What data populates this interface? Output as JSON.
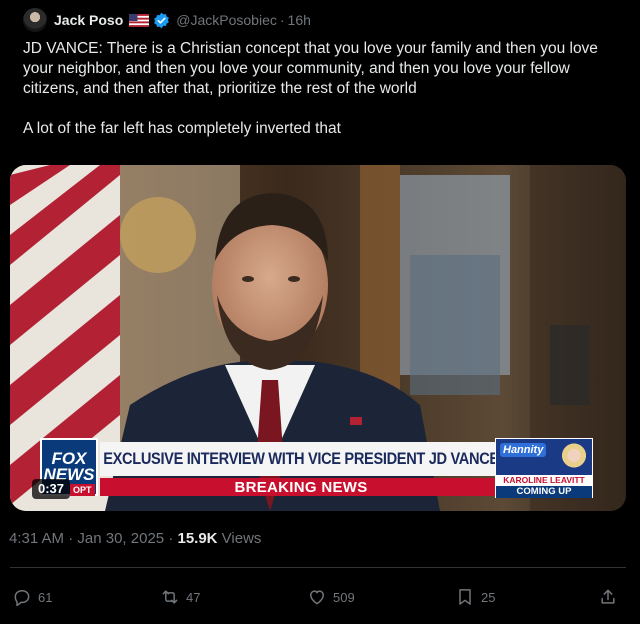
{
  "tweet": {
    "author": {
      "display_name": "Jack Poso",
      "handle": "@JackPosobiec",
      "flag_icon": "us-flag-icon",
      "verified_icon": "verified-badge-icon",
      "verified_color": "#1d9bf0"
    },
    "separator": "·",
    "time_ago": "16h",
    "paragraphs": [
      "JD VANCE: There is a Christian concept that you love your family and then you love your neighbor, and then you love your community, and then you love your fellow citizens, and then after that, prioritize the rest of the world",
      "A lot of the far left has completely inverted that"
    ],
    "video": {
      "duration": "0:37",
      "chyron_logo_top": "FOX",
      "chyron_logo_bottom": "NEWS",
      "chyron_logo_tag": "OPT",
      "headline": "EXCLUSIVE INTERVIEW WITH VICE PRESIDENT JD VANCE",
      "breaking": "BREAKING NEWS",
      "promo_show": "Hannity",
      "promo_name": "KAROLINE LEAVITT",
      "promo_coming": "COMING UP",
      "brand_red": "#c8102e",
      "brand_blue": "#0b3a7a"
    },
    "meta": {
      "time": "4:31 AM",
      "separator": "·",
      "date": "Jan 30, 2025",
      "separator2": "·",
      "views_count": "15.9K",
      "views_label": " Views"
    },
    "actions": {
      "replies": "61",
      "reposts": "47",
      "likes": "509",
      "bookmarks": "25",
      "icons": [
        "reply-icon",
        "repost-icon",
        "like-icon",
        "bookmark-icon",
        "share-icon"
      ]
    }
  }
}
